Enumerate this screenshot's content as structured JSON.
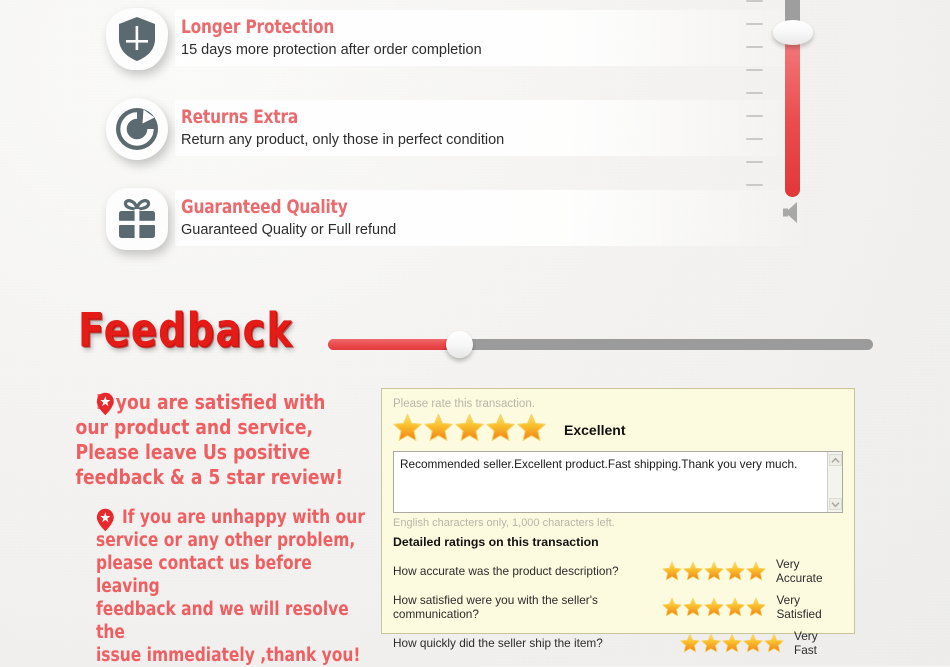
{
  "features": [
    {
      "icon": "shield-icon",
      "title": "Longer Protection",
      "desc": "15 days more protection after order completion"
    },
    {
      "icon": "refresh-icon",
      "title": "Returns Extra",
      "desc": "Return any product, only those in perfect condition"
    },
    {
      "icon": "gift-icon",
      "title": "Guaranteed Quality",
      "desc": "Guaranteed Quality or Full refund"
    }
  ],
  "vertical_slider": {
    "name": "volume-level-slider",
    "tick_count": 9,
    "fill_color": "#ea4b4b",
    "track_color": "#9e9e9e",
    "thumb_color": "#ffffff",
    "speaker_icon": "speaker-icon"
  },
  "heading": {
    "text": "Feedback",
    "color": "#e51b18"
  },
  "horizontal_slider": {
    "name": "feedback-progress-slider",
    "fill_percent": 24,
    "fill_color": "#ea4a4c",
    "track_color": "#9b9b9b",
    "thumb_color": "#ffffff"
  },
  "notes": [
    {
      "icon": "location-star-pin-icon",
      "lines": [
        "If you are satisfied with",
        "our product and service,",
        "Please leave Us positive",
        "feedback & a 5 star review!"
      ]
    },
    {
      "icon": "location-star-pin-icon",
      "lines": [
        "If you are unhappy with our",
        "service or any other problem,",
        "please contact us before leaving",
        "feedback and we will resolve the",
        "issue immediately ,thank you!"
      ]
    }
  ],
  "panel": {
    "hint": "Please rate this transaction.",
    "overall_stars": 5,
    "overall_word": "Excellent",
    "review_text": "Recommended seller.Excellent product.Fast shipping.Thank you very much.",
    "chars_left": "English characters only, 1,000 characters left.",
    "detailed_title": "Detailed ratings on this transaction",
    "ratings": [
      {
        "question": "How accurate was the product description?",
        "stars": 5,
        "word": "Very Accurate"
      },
      {
        "question": "How satisfied were you with the seller's communication?",
        "stars": 5,
        "word": "Very Satisfied"
      },
      {
        "question": "How quickly did the seller ship the item?",
        "stars": 5,
        "word": "Very Fast"
      }
    ],
    "background_color": "#fdfbdf",
    "border_color": "#c9c49a",
    "star_color": "#f5a623"
  }
}
